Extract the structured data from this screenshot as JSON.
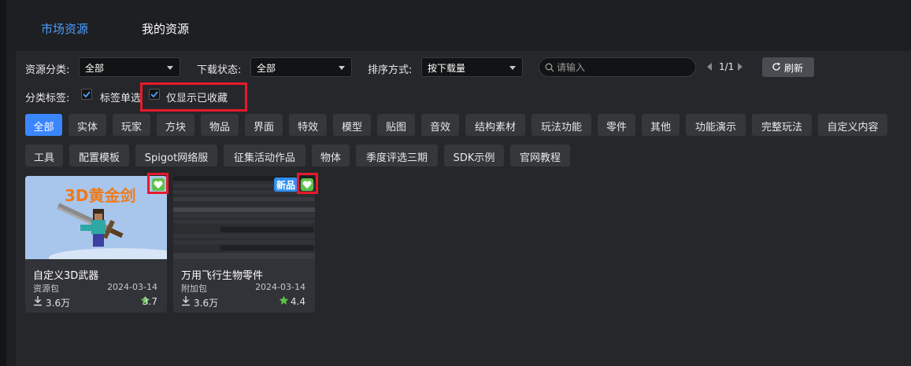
{
  "tabs": [
    {
      "label": "市场资源"
    },
    {
      "label": "我的资源"
    }
  ],
  "filters": {
    "category_label": "资源分类:",
    "category_value": "全部",
    "download_label": "下载状态:",
    "download_value": "全部",
    "sort_label": "排序方式:",
    "sort_value": "按下载量",
    "search_placeholder": "请输入",
    "page_indicator": "1/1",
    "refresh_label": "刷新",
    "tags_label": "分类标签:",
    "single_select_label": "标签单选",
    "single_select_checked": true,
    "favorites_only_label": "仅显示已收藏",
    "favorites_only_checked": true
  },
  "tags_row1": [
    "全部",
    "实体",
    "玩家",
    "方块",
    "物品",
    "界面",
    "特效",
    "模型",
    "贴图",
    "音效",
    "结构素材",
    "玩法功能",
    "零件",
    "其他",
    "功能演示",
    "完整玩法",
    "自定义内容"
  ],
  "tags_row2": [
    "工具",
    "配置模板",
    "Spigot网络服",
    "征集活动作品",
    "物体",
    "季度评选三期",
    "SDK示例",
    "官网教程"
  ],
  "active_tag": "全部",
  "cards": [
    {
      "thumb_text": "3D黄金剑",
      "title": "自定义3D武器",
      "type": "资源包",
      "date": "2024-03-14",
      "downloads": "3.6万",
      "rating": "3.7",
      "favorited": true
    },
    {
      "badge": "新品",
      "title": "万用飞行生物零件",
      "type": "附加包",
      "date": "2024-03-14",
      "downloads": "3.6万",
      "rating": "4.4",
      "favorited": true
    }
  ],
  "colors": {
    "accent": "#3a86ff",
    "favorite": "#5cc24a",
    "highlight": "#e8192c",
    "star": "#5cc24a"
  }
}
